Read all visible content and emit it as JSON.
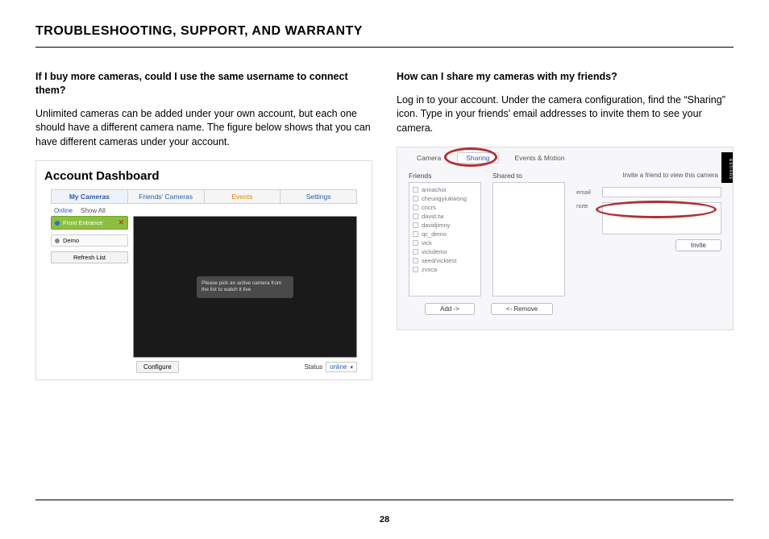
{
  "page": {
    "section_title": "TROUBLESHOOTING, SUPPORT, AND WARRANTY",
    "left": {
      "q": "If I buy more cameras, could I use the same username to connect them?",
      "a": "Unlimited cameras can be added under your own account, but each one should have a different camera name. The figure below shows that you can have different cameras under your account."
    },
    "right": {
      "q": "How can I share my cameras with my friends?",
      "a": "Log in to your account. Under the camera configuration, find the “Sharing” icon. Type in your friends' email addresses to invite them to see your camera."
    },
    "number": "28"
  },
  "dashboard": {
    "title": "Account Dashboard",
    "tabs": {
      "my": "My Cameras",
      "friends": "Friends' Cameras",
      "events": "Events",
      "settings": "Settings"
    },
    "subtabs": {
      "online": "Online",
      "show_all": "Show All"
    },
    "cameras": {
      "selected": "Front Entrance",
      "demo": "Demo"
    },
    "refresh_btn": "Refresh List",
    "overlay": "Please pick an active camera from the list to watch it live",
    "configure_btn": "Configure",
    "status_label": "Status",
    "status_value": "online"
  },
  "sharing": {
    "tabs": {
      "camera": "Camera",
      "sharing": "Sharing",
      "events_motion": "Events & Motion"
    },
    "friends_label": "Friends",
    "shared_label": "Shared to",
    "invite_header": "Invite a friend to view this camera",
    "friends": [
      "annachoi",
      "cheungyiukwong",
      "cncrs",
      "david.tw",
      "davidjimny",
      "qc_demo",
      "vick",
      "vickdemo",
      "seed/vicktest",
      "zvsca"
    ],
    "email_label": "email",
    "note_label": "note",
    "invite_btn": "Invite",
    "add_btn": "Add ->",
    "remove_btn": "<- Remove",
    "side_tab": "estions"
  }
}
